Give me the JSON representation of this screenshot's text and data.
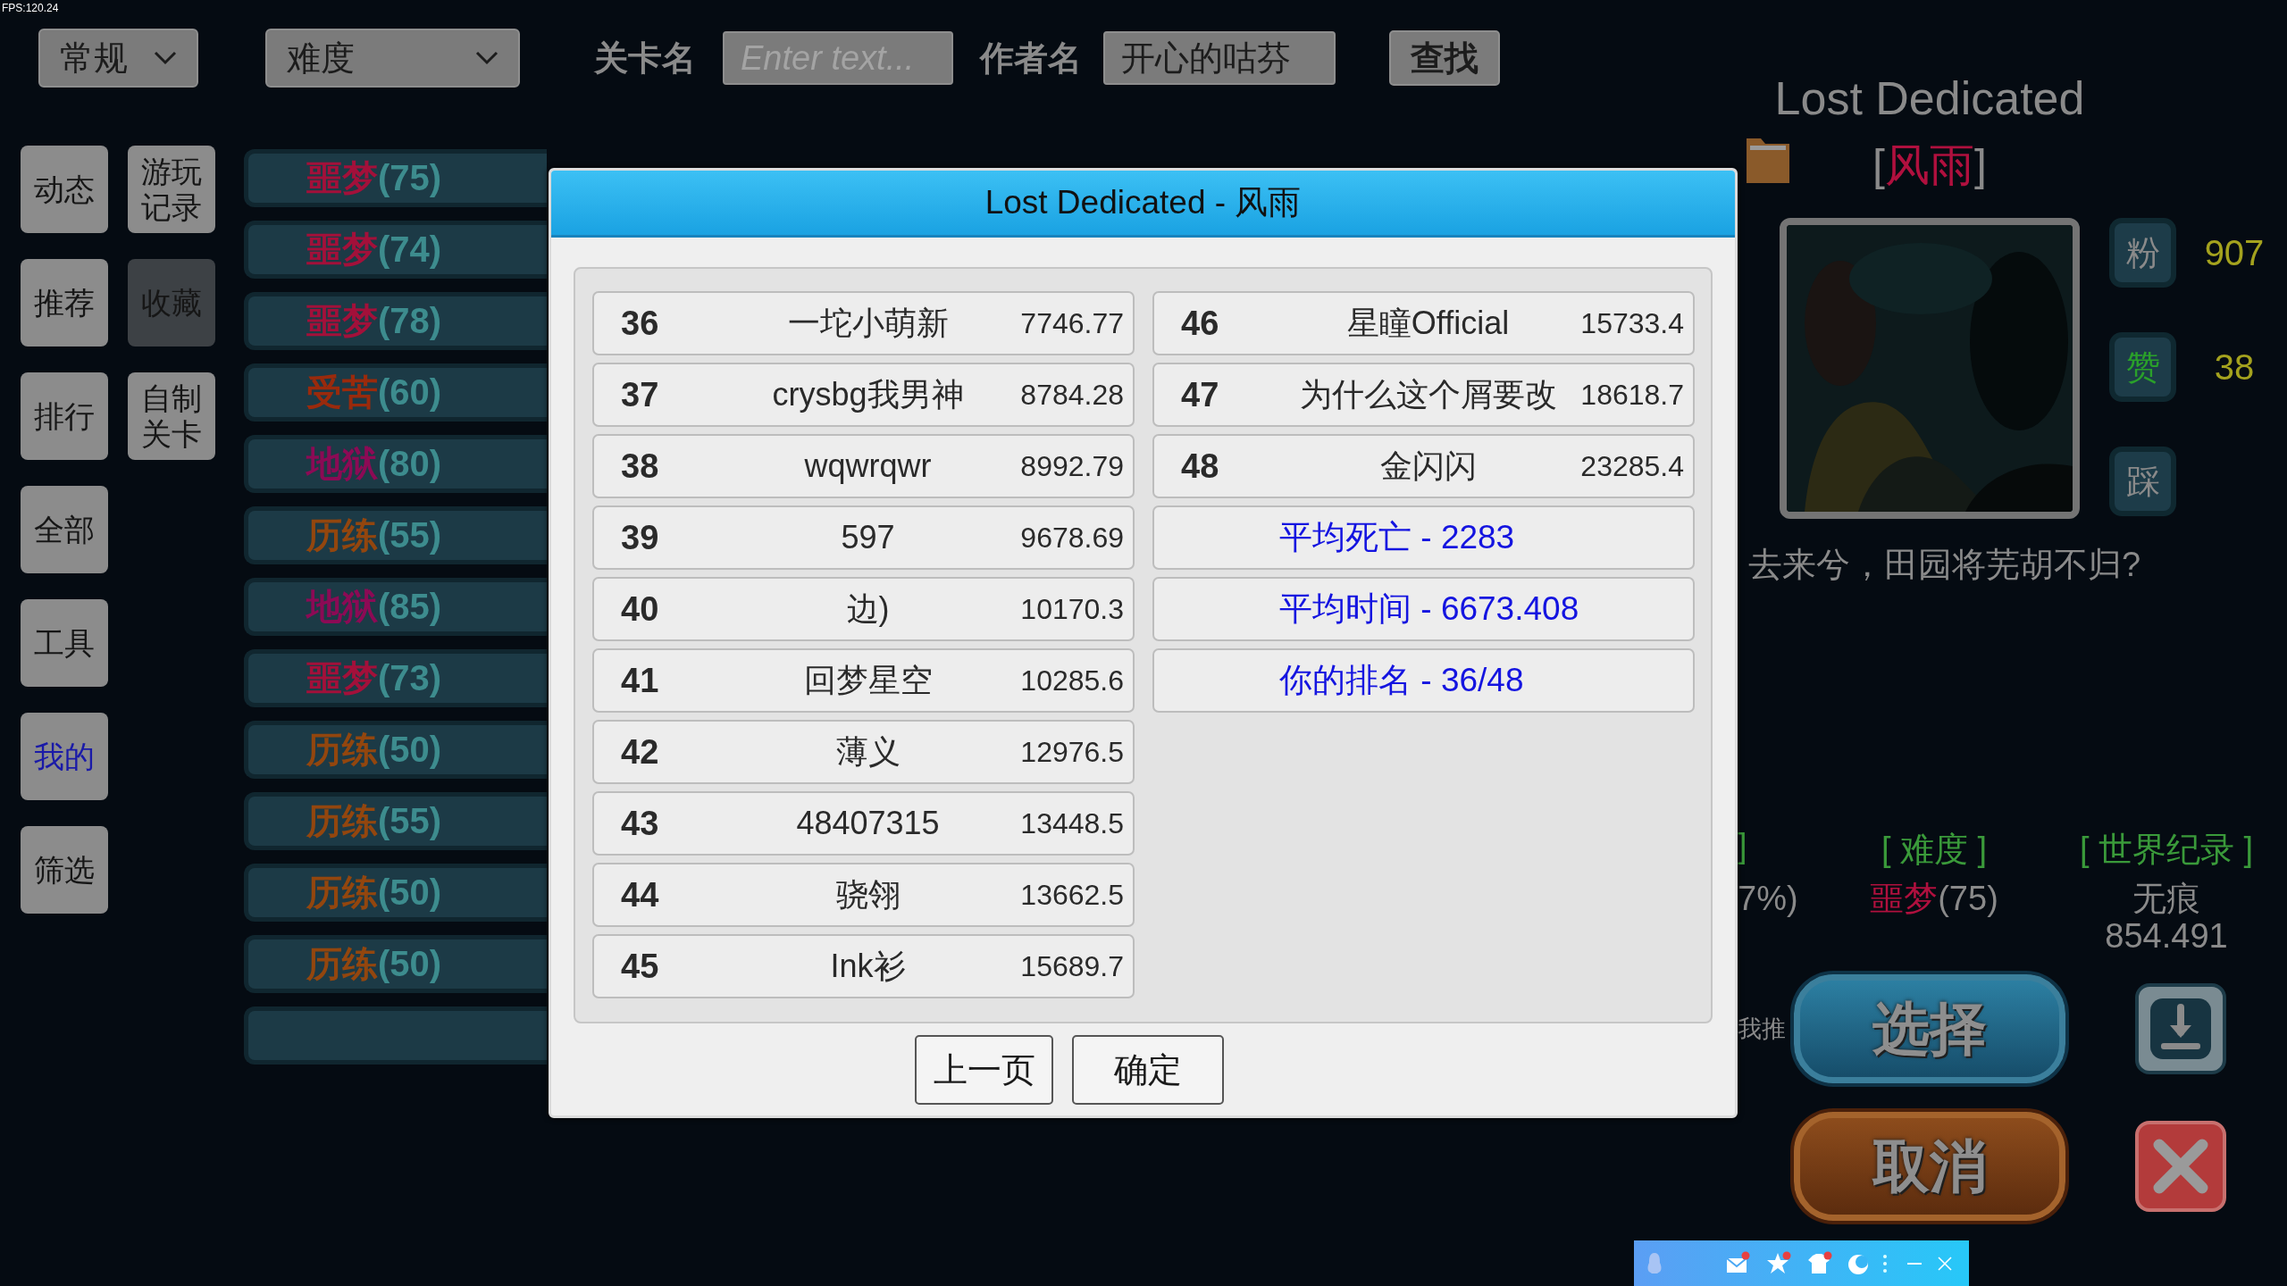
{
  "fps": "FPS:120.24",
  "filters": {
    "category": {
      "value": "常规"
    },
    "difficulty": {
      "value": "难度"
    },
    "level_name": {
      "label": "关卡名",
      "placeholder": "Enter text..."
    },
    "author": {
      "label": "作者名",
      "value": "开心的咕芬"
    },
    "search_button": "查找"
  },
  "sidebar": {
    "primary": [
      {
        "label": "动态",
        "selected": false,
        "current": false
      },
      {
        "label": "推荐",
        "selected": false,
        "current": false
      },
      {
        "label": "排行",
        "selected": false,
        "current": false
      },
      {
        "label": "全部",
        "selected": false,
        "current": false
      },
      {
        "label": "工具",
        "selected": false,
        "current": false
      },
      {
        "label": "我的",
        "selected": false,
        "current": true
      },
      {
        "label": "筛选",
        "selected": false,
        "current": false
      }
    ],
    "secondary": [
      {
        "label": "游玩记录",
        "selected": false,
        "current": false
      },
      {
        "label": "收藏",
        "selected": true,
        "current": false
      },
      {
        "label": "自制关卡",
        "selected": false,
        "current": false
      }
    ]
  },
  "levels": [
    {
      "kind": "entry",
      "difficulty": "噩梦",
      "score": "(75)",
      "color": "#a3103a"
    },
    {
      "kind": "entry",
      "difficulty": "噩梦",
      "score": "(74)",
      "color": "#a3103a"
    },
    {
      "kind": "entry",
      "difficulty": "噩梦",
      "score": "(78)",
      "color": "#a3103a"
    },
    {
      "kind": "entry",
      "difficulty": "受苦",
      "score": "(60)",
      "color": "#9a2a0c"
    },
    {
      "kind": "entry",
      "difficulty": "地狱",
      "score": "(80)",
      "color": "#8c0a55"
    },
    {
      "kind": "entry",
      "difficulty": "历练",
      "score": "(55)",
      "color": "#93460e"
    },
    {
      "kind": "entry",
      "difficulty": "地狱",
      "score": "(85)",
      "color": "#8c0a55"
    },
    {
      "kind": "entry",
      "difficulty": "噩梦",
      "score": "(73)",
      "color": "#a3103a"
    },
    {
      "kind": "entry",
      "difficulty": "历练",
      "score": "(50)",
      "color": "#93460e"
    },
    {
      "kind": "entry",
      "difficulty": "历练",
      "score": "(55)",
      "color": "#93460e"
    },
    {
      "kind": "entry",
      "difficulty": "历练",
      "score": "(50)",
      "color": "#93460e"
    },
    {
      "kind": "entry",
      "difficulty": "历练",
      "score": "(50)",
      "color": "#93460e"
    },
    {
      "kind": "blank"
    }
  ],
  "dialog": {
    "title": "Lost Dedicated - 风雨",
    "ranking": [
      {
        "rank": "36",
        "name": "一坨小萌新",
        "time": "7746.77"
      },
      {
        "rank": "37",
        "name": "crysbg我男神",
        "time": "8784.28"
      },
      {
        "rank": "38",
        "name": "wqwrqwr",
        "time": "8992.79"
      },
      {
        "rank": "39",
        "name": "597",
        "time": "9678.69"
      },
      {
        "rank": "40",
        "name": "边)",
        "time": "10170.3"
      },
      {
        "rank": "41",
        "name": "回梦星空",
        "time": "10285.6"
      },
      {
        "rank": "42",
        "name": "薄义",
        "time": "12976.5"
      },
      {
        "rank": "43",
        "name": "48407315",
        "time": "13448.5"
      },
      {
        "rank": "44",
        "name": "骁翎",
        "time": "13662.5"
      },
      {
        "rank": "45",
        "name": "Ink衫",
        "time": "15689.7"
      },
      {
        "rank": "46",
        "name": "星瞳Official",
        "time": "15733.4"
      },
      {
        "rank": "47",
        "name": "为什么这个屑要改",
        "time": "18618.7"
      },
      {
        "rank": "48",
        "name": "金闪闪",
        "time": "23285.4"
      }
    ],
    "summary": [
      "平均死亡 - 2283",
      "平均时间 - 6673.408",
      "你的排名 - 36/48"
    ],
    "buttons": [
      "上一页",
      "确定"
    ]
  },
  "info": {
    "level_title": "Lost Dedicated",
    "author_tag": {
      "prefix": "[",
      "name": "风雨",
      "suffix": "]"
    },
    "reactions": [
      {
        "kind": "fans",
        "label": "粉",
        "count": "907"
      },
      {
        "kind": "likes",
        "label": "赞",
        "count": "38"
      },
      {
        "kind": "dislikes",
        "label": "踩"
      }
    ],
    "description": "去来兮，田园将芜胡不归?",
    "stats": [
      {
        "kind": "plain",
        "header": "]",
        "values": [
          "7%)"
        ]
      },
      {
        "kind": "difficulty",
        "header": "[ 难度 ]",
        "difficulty": "噩梦",
        "score": "(75)",
        "color": "#b0103e"
      },
      {
        "kind": "plain",
        "header": "[ 世界纪录 ]",
        "values": [
          "无痕",
          "854.491"
        ]
      }
    ],
    "recommend_note": "我推",
    "select_button": "选择",
    "cancel_button": "取消"
  },
  "taskbar": {
    "icons": [
      {
        "kind": "mail",
        "badge": true
      },
      {
        "kind": "star",
        "badge": true
      },
      {
        "kind": "shirt",
        "badge": true
      },
      {
        "kind": "moon",
        "badge": false
      }
    ]
  }
}
